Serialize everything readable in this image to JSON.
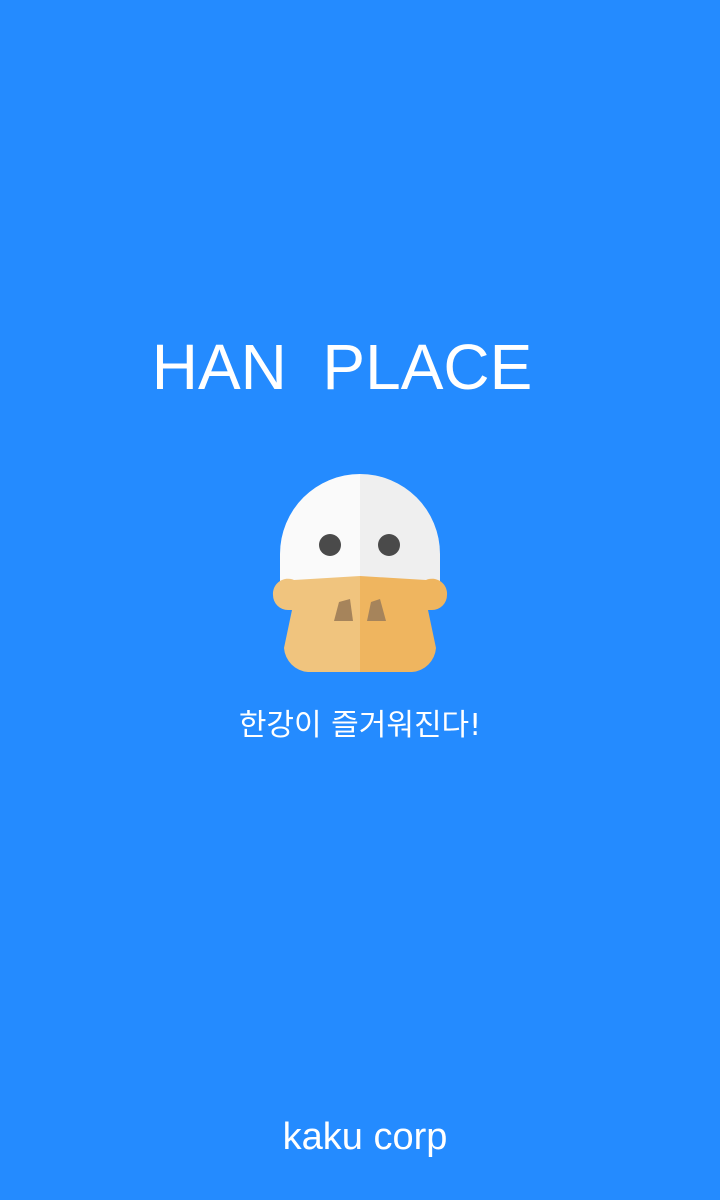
{
  "screen": {
    "background_color": "#248bff",
    "title": "HAN  PLACE",
    "tagline": "한강이 즐거워진다!",
    "company": "kaku corp"
  },
  "mascot": {
    "icon": "duck-mascot-icon",
    "head_color_left": "#fafafa",
    "head_color_right": "#efefef",
    "eye_color": "#4a4a4a",
    "beak_color_left": "#f0c47e",
    "beak_color_right": "#efb55f",
    "nostril_color": "#a6845b"
  }
}
